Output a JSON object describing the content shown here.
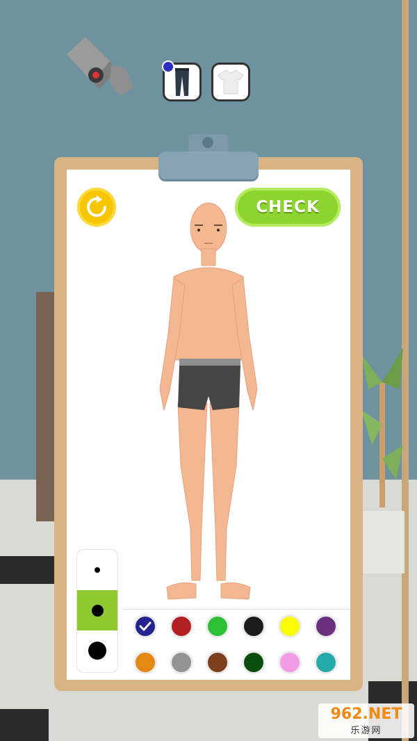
{
  "header": {
    "tabs": [
      {
        "icon": "pants-icon",
        "selected": true
      },
      {
        "icon": "shirt-icon",
        "selected": false
      }
    ]
  },
  "board": {
    "reset_icon": "refresh-icon",
    "check_label": "CHECK"
  },
  "brush_sizes": [
    {
      "name": "small",
      "selected": false
    },
    {
      "name": "medium",
      "selected": true
    },
    {
      "name": "large",
      "selected": false
    }
  ],
  "colors": [
    {
      "hex": "#23248f",
      "selected": true
    },
    {
      "hex": "#b32024"
    },
    {
      "hex": "#2dbf36"
    },
    {
      "hex": "#1c1c1c"
    },
    {
      "hex": "#fbfb00"
    },
    {
      "hex": "#6a2f7d"
    },
    {
      "hex": "#e38813"
    },
    {
      "hex": "#939393"
    },
    {
      "hex": "#7e3f1f"
    },
    {
      "hex": "#0c4d0e"
    },
    {
      "hex": "#f29ce6"
    },
    {
      "hex": "#25aaa9"
    }
  ],
  "watermark": {
    "line1": "962.NET",
    "line2": "乐游网"
  }
}
